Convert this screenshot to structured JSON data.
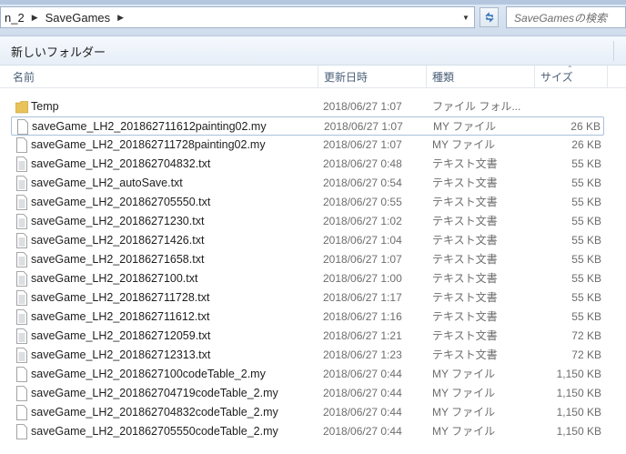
{
  "address": {
    "crumbs": [
      "n_2",
      "SaveGames"
    ],
    "search_placeholder": "SaveGamesの検索"
  },
  "toolbar": {
    "new_folder_label": "新しいフォルダー"
  },
  "columns": {
    "name": "名前",
    "date": "更新日時",
    "type": "種類",
    "size": "サイズ"
  },
  "files": [
    {
      "name": "Temp",
      "date": "2018/06/27 1:07",
      "type": "ファイル フォル...",
      "size": "",
      "icon": "folder-icon"
    },
    {
      "name": "saveGame_LH2_201862711612painting02.my",
      "date": "2018/06/27 1:07",
      "type": "MY ファイル",
      "size": "26 KB",
      "icon": "file-icon"
    },
    {
      "name": "saveGame_LH2_201862711728painting02.my",
      "date": "2018/06/27 1:07",
      "type": "MY ファイル",
      "size": "26 KB",
      "icon": "file-icon"
    },
    {
      "name": "saveGame_LH2_201862704832.txt",
      "date": "2018/06/27 0:48",
      "type": "テキスト文書",
      "size": "55 KB",
      "icon": "text-file-icon"
    },
    {
      "name": "saveGame_LH2_autoSave.txt",
      "date": "2018/06/27 0:54",
      "type": "テキスト文書",
      "size": "55 KB",
      "icon": "text-file-icon"
    },
    {
      "name": "saveGame_LH2_201862705550.txt",
      "date": "2018/06/27 0:55",
      "type": "テキスト文書",
      "size": "55 KB",
      "icon": "text-file-icon"
    },
    {
      "name": "saveGame_LH2_20186271230.txt",
      "date": "2018/06/27 1:02",
      "type": "テキスト文書",
      "size": "55 KB",
      "icon": "text-file-icon"
    },
    {
      "name": "saveGame_LH2_20186271426.txt",
      "date": "2018/06/27 1:04",
      "type": "テキスト文書",
      "size": "55 KB",
      "icon": "text-file-icon"
    },
    {
      "name": "saveGame_LH2_20186271658.txt",
      "date": "2018/06/27 1:07",
      "type": "テキスト文書",
      "size": "55 KB",
      "icon": "text-file-icon"
    },
    {
      "name": "saveGame_LH2_2018627100.txt",
      "date": "2018/06/27 1:00",
      "type": "テキスト文書",
      "size": "55 KB",
      "icon": "text-file-icon"
    },
    {
      "name": "saveGame_LH2_201862711728.txt",
      "date": "2018/06/27 1:17",
      "type": "テキスト文書",
      "size": "55 KB",
      "icon": "text-file-icon"
    },
    {
      "name": "saveGame_LH2_201862711612.txt",
      "date": "2018/06/27 1:16",
      "type": "テキスト文書",
      "size": "55 KB",
      "icon": "text-file-icon"
    },
    {
      "name": "saveGame_LH2_201862712059.txt",
      "date": "2018/06/27 1:21",
      "type": "テキスト文書",
      "size": "72 KB",
      "icon": "text-file-icon"
    },
    {
      "name": "saveGame_LH2_201862712313.txt",
      "date": "2018/06/27 1:23",
      "type": "テキスト文書",
      "size": "72 KB",
      "icon": "text-file-icon"
    },
    {
      "name": "saveGame_LH2_2018627100codeTable_2.my",
      "date": "2018/06/27 0:44",
      "type": "MY ファイル",
      "size": "1,150 KB",
      "icon": "file-icon"
    },
    {
      "name": "saveGame_LH2_201862704719codeTable_2.my",
      "date": "2018/06/27 0:44",
      "type": "MY ファイル",
      "size": "1,150 KB",
      "icon": "file-icon"
    },
    {
      "name": "saveGame_LH2_201862704832codeTable_2.my",
      "date": "2018/06/27 0:44",
      "type": "MY ファイル",
      "size": "1,150 KB",
      "icon": "file-icon"
    },
    {
      "name": "saveGame_LH2_201862705550codeTable_2.my",
      "date": "2018/06/27 0:44",
      "type": "MY ファイル",
      "size": "1,150 KB",
      "icon": "file-icon"
    }
  ],
  "selected_index": 1,
  "colors": {
    "folder": "#e8c25a",
    "selection_border": "#a9c0da",
    "header_text": "#4c607a"
  }
}
